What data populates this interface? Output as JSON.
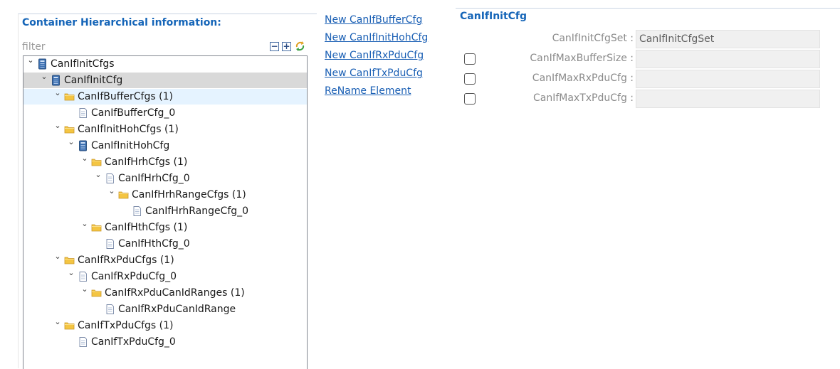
{
  "left_panel": {
    "title": "Container Hierarchical information:",
    "filter_placeholder": "filter",
    "toolbar": {
      "collapse_all": "collapse-all-icon",
      "expand_all": "expand-all-icon",
      "sync": "sync-icon"
    },
    "tree": [
      {
        "label": "CanIfInitCfgs",
        "depth": 0,
        "expanded": true,
        "icon": "module-icon"
      },
      {
        "label": "CanIfInitCfg",
        "depth": 1,
        "expanded": true,
        "icon": "container-icon",
        "selected": true
      },
      {
        "label": "CanIfBufferCfgs (1)",
        "depth": 2,
        "expanded": true,
        "icon": "folder-icon",
        "hover": true
      },
      {
        "label": "CanIfBufferCfg_0",
        "depth": 3,
        "expanded": null,
        "icon": "document-icon"
      },
      {
        "label": "CanIfInitHohCfgs (1)",
        "depth": 2,
        "expanded": true,
        "icon": "folder-icon"
      },
      {
        "label": "CanIfInitHohCfg",
        "depth": 3,
        "expanded": true,
        "icon": "container-icon"
      },
      {
        "label": "CanIfHrhCfgs (1)",
        "depth": 4,
        "expanded": true,
        "icon": "folder-icon"
      },
      {
        "label": "CanIfHrhCfg_0",
        "depth": 5,
        "expanded": true,
        "icon": "document-icon"
      },
      {
        "label": "CanIfHrhRangeCfgs (1)",
        "depth": 6,
        "expanded": true,
        "icon": "folder-icon"
      },
      {
        "label": "CanIfHrhRangeCfg_0",
        "depth": 7,
        "expanded": null,
        "icon": "document-icon"
      },
      {
        "label": "CanIfHthCfgs (1)",
        "depth": 4,
        "expanded": true,
        "icon": "folder-icon"
      },
      {
        "label": "CanIfHthCfg_0",
        "depth": 5,
        "expanded": null,
        "icon": "document-icon"
      },
      {
        "label": "CanIfRxPduCfgs (1)",
        "depth": 2,
        "expanded": true,
        "icon": "folder-icon"
      },
      {
        "label": "CanIfRxPduCfg_0",
        "depth": 3,
        "expanded": true,
        "icon": "document-icon"
      },
      {
        "label": "CanIfRxPduCanIdRanges (1)",
        "depth": 4,
        "expanded": true,
        "icon": "folder-icon"
      },
      {
        "label": "CanIfRxPduCanIdRange",
        "depth": 5,
        "expanded": null,
        "icon": "document-icon"
      },
      {
        "label": "CanIfTxPduCfgs (1)",
        "depth": 2,
        "expanded": true,
        "icon": "folder-icon"
      },
      {
        "label": "CanIfTxPduCfg_0",
        "depth": 3,
        "expanded": null,
        "icon": "document-icon"
      }
    ]
  },
  "actions": [
    "New CanIfBufferCfg",
    "New CanIfInitHohCfg",
    "New CanIfRxPduCfg",
    "New CanIfTxPduCfg",
    "ReName Element"
  ],
  "right_panel": {
    "title": "CanIfInitCfg",
    "params": [
      {
        "label": "CanIfInitCfgSet :",
        "value": "CanIfInitCfgSet",
        "has_checkbox": false
      },
      {
        "label": "CanIfMaxBufferSize :",
        "value": "",
        "has_checkbox": true,
        "checked": false
      },
      {
        "label": "CanIfMaxRxPduCfg :",
        "value": "",
        "has_checkbox": true,
        "checked": false
      },
      {
        "label": "CanIfMaxTxPduCfg :",
        "value": "",
        "has_checkbox": true,
        "checked": false
      }
    ]
  },
  "colors": {
    "title_blue": "#1565b8",
    "link_blue": "#1a5fb4",
    "selected_row": "#d9d9d9",
    "hover_row": "#e5f3ff",
    "folder_yellow": "#f4c542",
    "module_blue": "#3c6fb0"
  }
}
